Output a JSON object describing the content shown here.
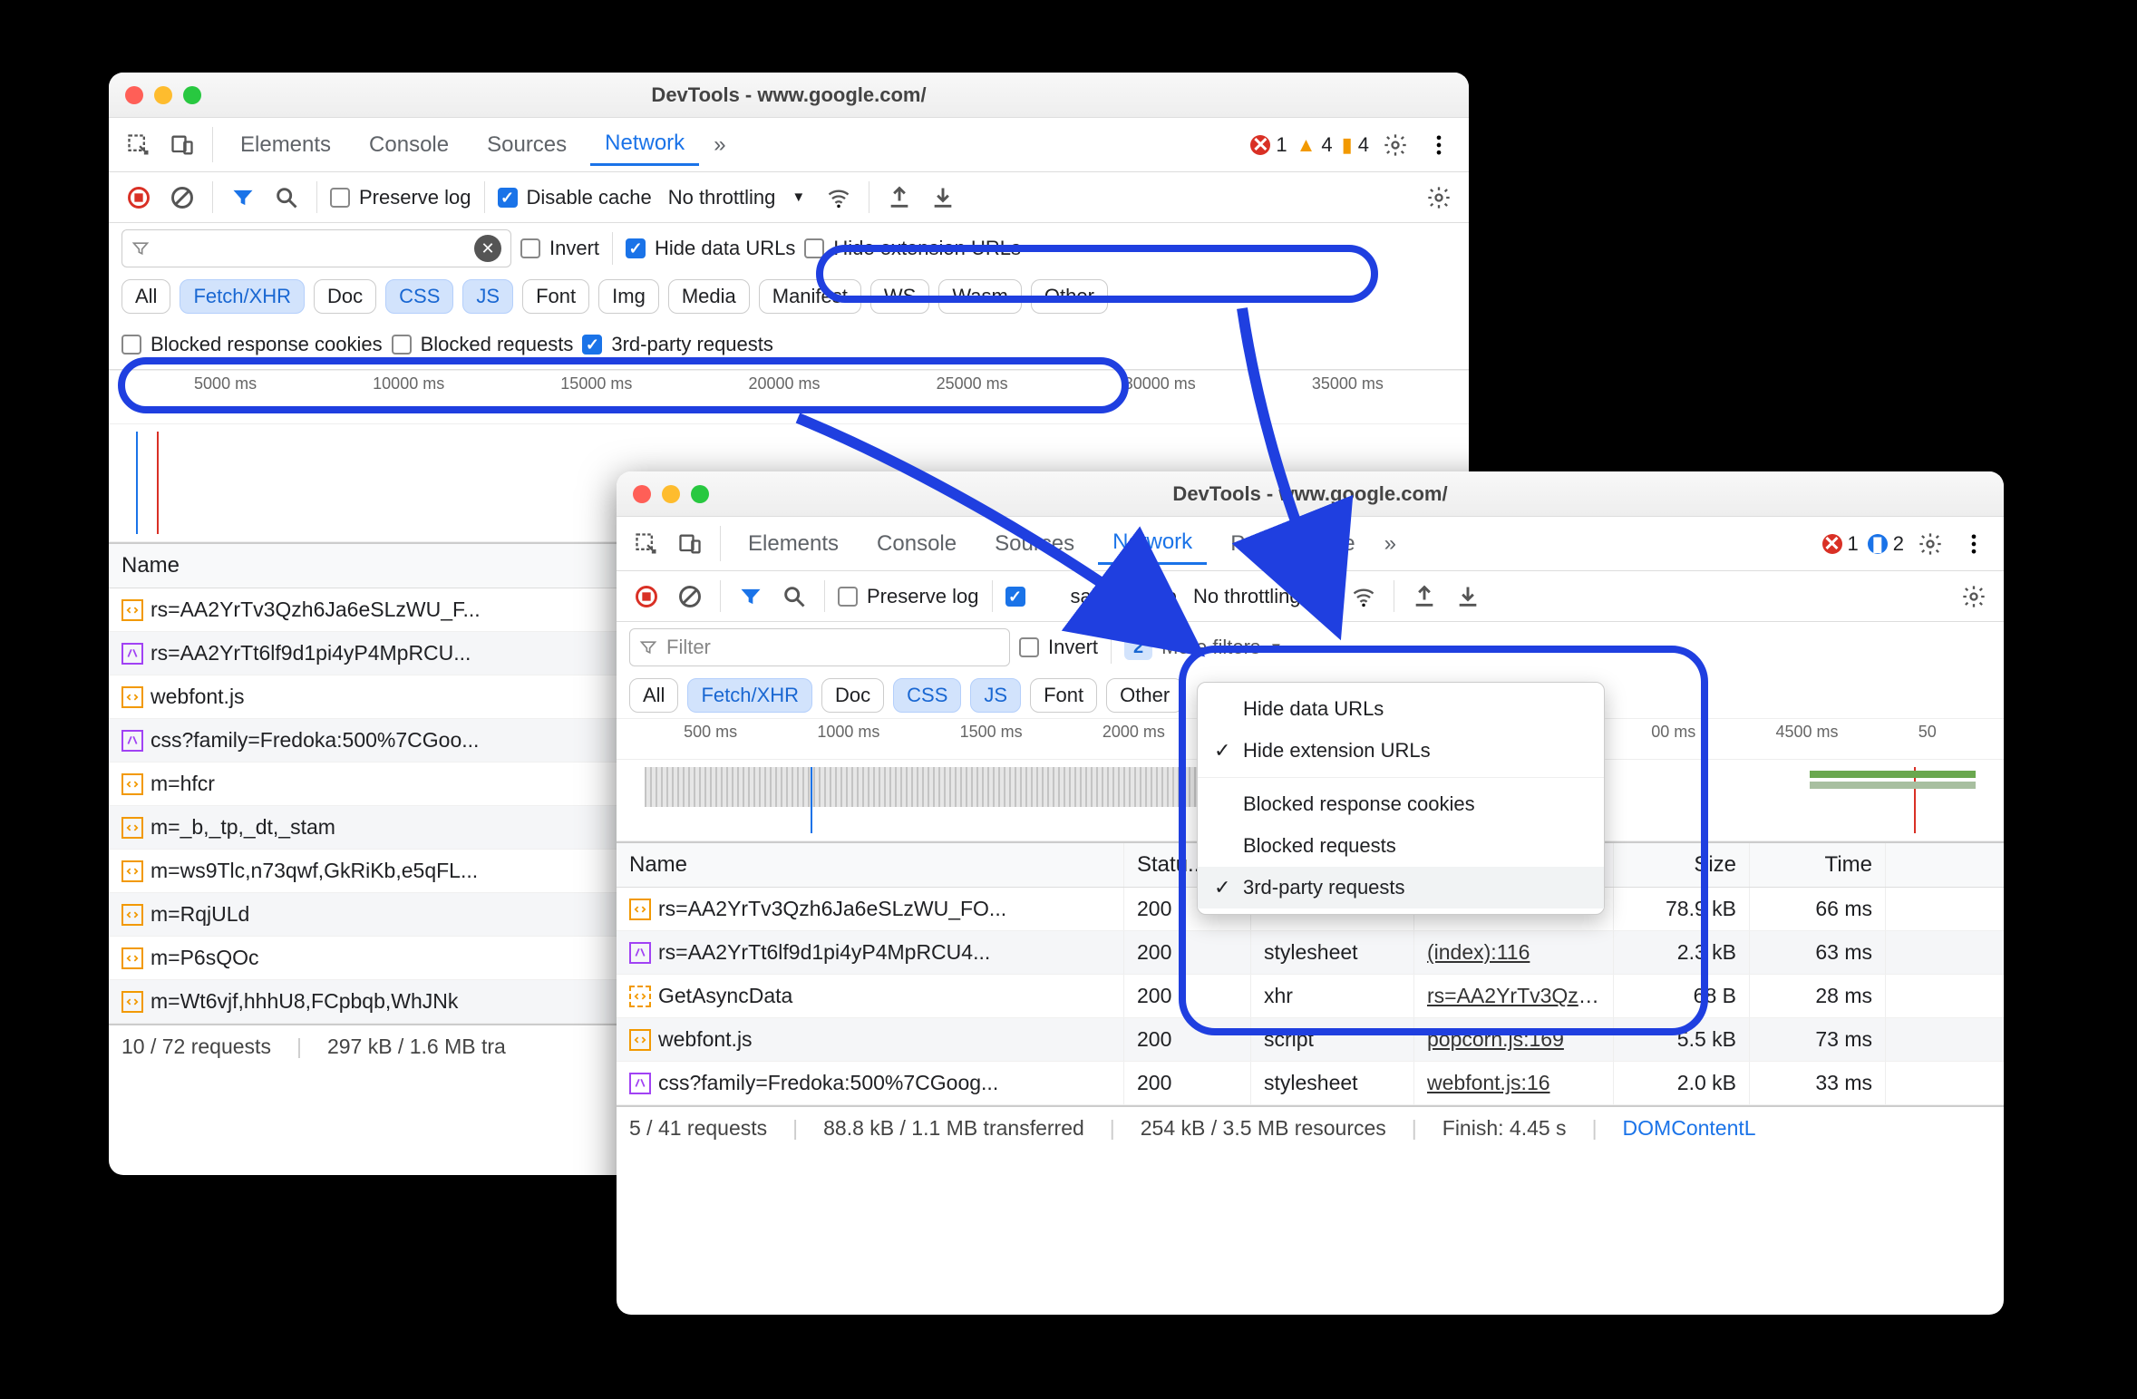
{
  "windowA": {
    "title": "DevTools - www.google.com/",
    "tabs": {
      "elements": "Elements",
      "console": "Console",
      "sources": "Sources",
      "network": "Network"
    },
    "counters": {
      "errors": "1",
      "warnings": "4",
      "issues": "4"
    },
    "toolbar2": {
      "preserve": "Preserve log",
      "disablecache": "Disable cache",
      "throttling": "No throttling"
    },
    "filterRow": {
      "invert": "Invert",
      "hidedata": "Hide data URLs",
      "hideext": "Hide extension URLs"
    },
    "types": [
      "All",
      "Fetch/XHR",
      "Doc",
      "CSS",
      "JS",
      "Font",
      "Img",
      "Media",
      "Manifest",
      "WS",
      "Wasm",
      "Other"
    ],
    "moreFilters": {
      "brc": "Blocked response cookies",
      "br": "Blocked requests",
      "third": "3rd-party requests"
    },
    "ticks": [
      "5000 ms",
      "10000 ms",
      "15000 ms",
      "20000 ms",
      "25000 ms",
      "30000 ms",
      "35000 ms"
    ],
    "nameHeader": "Name",
    "rows": [
      {
        "icon": "script",
        "name": "rs=AA2YrTv3Qzh6Ja6eSLzWU_F..."
      },
      {
        "icon": "style",
        "name": "rs=AA2YrTt6lf9d1pi4yP4MpRCU..."
      },
      {
        "icon": "script",
        "name": "webfont.js"
      },
      {
        "icon": "style",
        "name": "css?family=Fredoka:500%7CGoo..."
      },
      {
        "icon": "script",
        "name": "m=hfcr"
      },
      {
        "icon": "script",
        "name": "m=_b,_tp,_dt,_stam"
      },
      {
        "icon": "script",
        "name": "m=ws9Tlc,n73qwf,GkRiKb,e5qFL..."
      },
      {
        "icon": "script",
        "name": "m=RqjULd"
      },
      {
        "icon": "script",
        "name": "m=P6sQOc"
      },
      {
        "icon": "script",
        "name": "m=Wt6vjf,hhhU8,FCpbqb,WhJNk"
      }
    ],
    "status": {
      "a": "10 / 72 requests",
      "b": "297 kB / 1.6 MB tra"
    }
  },
  "windowB": {
    "title": "DevTools - www.google.com/",
    "tabs": {
      "elements": "Elements",
      "console": "Console",
      "sources": "Sources",
      "network": "Network",
      "performance": "Performance"
    },
    "counters": {
      "errors": "1",
      "info": "2"
    },
    "toolbar2": {
      "preserve": "Preserve log",
      "disablecache": "sable cache",
      "disablecache_pre": "",
      "throttling": "No throttling"
    },
    "filterRow": {
      "invert": "Invert",
      "placeholder": "Filter",
      "moreBadge": "2",
      "moreLabel": "More filters"
    },
    "types": [
      "All",
      "Fetch/XHR",
      "Doc",
      "CSS",
      "JS",
      "Font",
      "Other"
    ],
    "ticks": [
      "500 ms",
      "1000 ms",
      "1500 ms",
      "2000 ms",
      "00 ms",
      "4500 ms",
      "50"
    ],
    "dropdown": {
      "hidedata": "Hide data URLs",
      "hideext": "Hide extension URLs",
      "brc": "Blocked response cookies",
      "br": "Blocked requests",
      "third": "3rd-party requests"
    },
    "headers": {
      "name": "Name",
      "status": "Statu...",
      "type": "",
      "initiator": "",
      "size": "Size",
      "time": "Time"
    },
    "rows": [
      {
        "icon": "script",
        "name": "rs=AA2YrTv3Qzh6Ja6eSLzWU_FO...",
        "status": "200",
        "type": "",
        "initiator": "",
        "size": "78.9 kB",
        "time": "66 ms"
      },
      {
        "icon": "style",
        "name": "rs=AA2YrTt6lf9d1pi4yP4MpRCU4...",
        "status": "200",
        "type": "stylesheet",
        "initiator": "(index):116",
        "size": "2.3 kB",
        "time": "63 ms"
      },
      {
        "icon": "dashed",
        "name": "GetAsyncData",
        "status": "200",
        "type": "xhr",
        "initiator": "rs=AA2YrTv3Qzh6J",
        "size": "68 B",
        "time": "28 ms"
      },
      {
        "icon": "script",
        "name": "webfont.js",
        "status": "200",
        "type": "script",
        "initiator": "popcorn.js:169",
        "size": "5.5 kB",
        "time": "73 ms"
      },
      {
        "icon": "style",
        "name": "css?family=Fredoka:500%7CGoog...",
        "status": "200",
        "type": "stylesheet",
        "initiator": "webfont.js:16",
        "size": "2.0 kB",
        "time": "33 ms"
      }
    ],
    "status": {
      "a": "5 / 41 requests",
      "b": "88.8 kB / 1.1 MB transferred",
      "c": "254 kB / 3.5 MB resources",
      "d": "Finish: 4.45 s",
      "e": "DOMContentL"
    }
  }
}
